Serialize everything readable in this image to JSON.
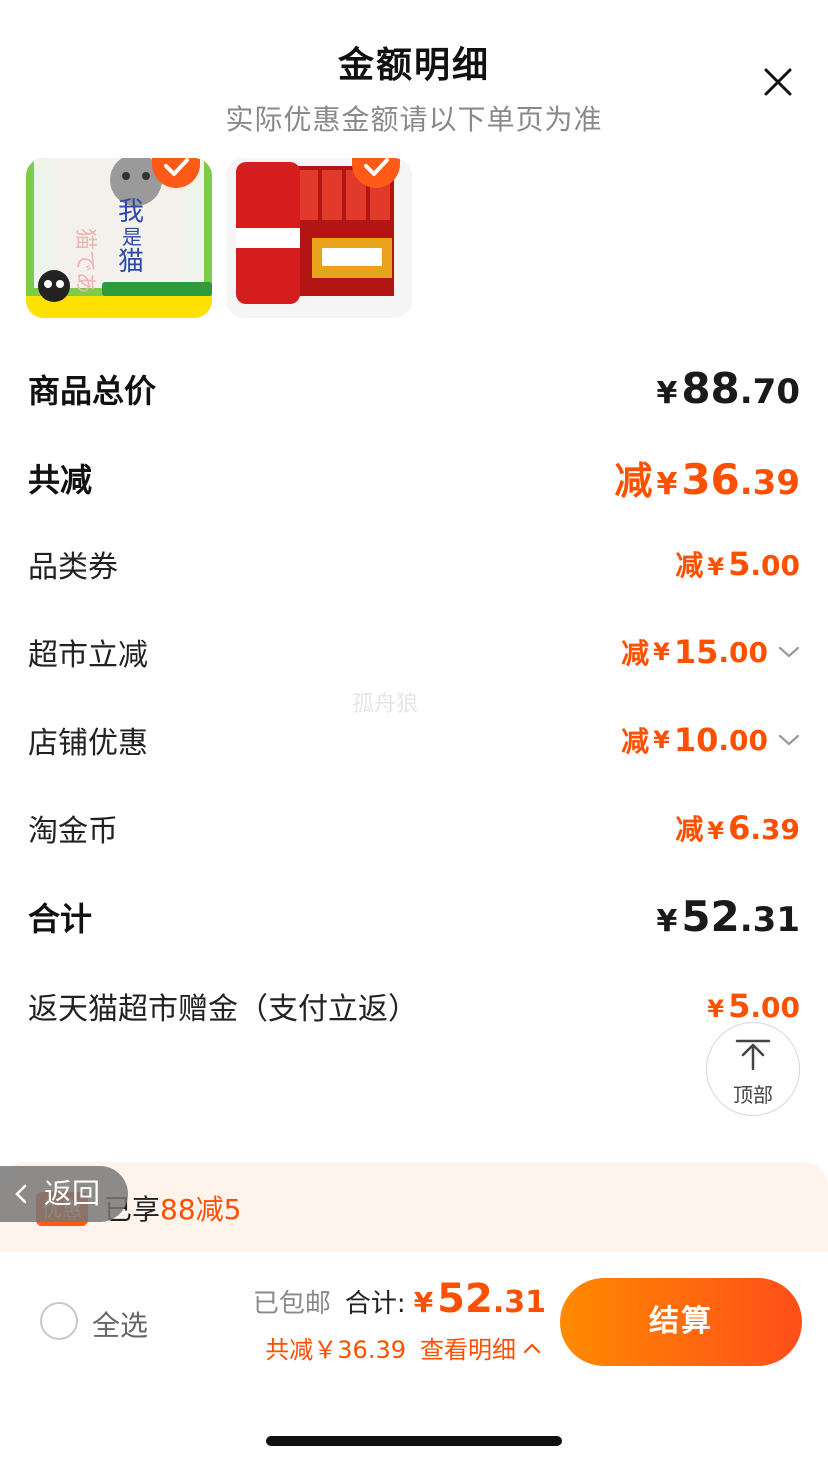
{
  "header": {
    "title": "金额明细",
    "subtitle": "实际优惠金额请以下单页为准"
  },
  "products": [
    {
      "name": "book-我是猫",
      "selected": true
    },
    {
      "name": "wusu-beer",
      "selected": true
    }
  ],
  "summary": {
    "total_price": {
      "label": "商品总价",
      "currency": "¥",
      "int": "88",
      "dec": ".70"
    },
    "total_discount": {
      "label": "共减",
      "prefix": "减",
      "currency": "¥",
      "int": "36",
      "dec": ".39"
    },
    "discounts": [
      {
        "label": "品类券",
        "prefix": "减",
        "currency": "¥",
        "int": "5",
        "dec": ".00",
        "expandable": false
      },
      {
        "label": "超市立减",
        "prefix": "减",
        "currency": "¥",
        "int": "15",
        "dec": ".00",
        "expandable": true
      },
      {
        "label": "店铺优惠",
        "prefix": "减",
        "currency": "¥",
        "int": "10",
        "dec": ".00",
        "expandable": true
      },
      {
        "label": "淘金币",
        "prefix": "减",
        "currency": "¥",
        "int": "6",
        "dec": ".39",
        "expandable": false
      }
    ],
    "grand_total": {
      "label": "合计",
      "currency": "¥",
      "int": "52",
      "dec": ".31"
    },
    "cashback": {
      "label": "返天猫超市赠金（支付立返）",
      "currency": "¥",
      "int": "5",
      "dec": ".00"
    }
  },
  "to_top": {
    "label": "顶部"
  },
  "promo": {
    "tag": "优惠",
    "text": "已享",
    "highlight": "88减5"
  },
  "back": {
    "label": "返回"
  },
  "watermark": "孤舟狼",
  "bottom_bar": {
    "select_all": "全选",
    "free_shipping": "已包邮",
    "total_label": "合计:",
    "currency": "¥",
    "total_int": "52",
    "total_dec": ".31",
    "saved_text": "共减￥36.39",
    "detail_link": "查看明细",
    "checkout": "结算"
  },
  "colors": {
    "accent": "#ff5000",
    "checkout_start": "#ff8a00",
    "checkout_end": "#ff4e1a",
    "promo_bg": "#fff4ec"
  }
}
